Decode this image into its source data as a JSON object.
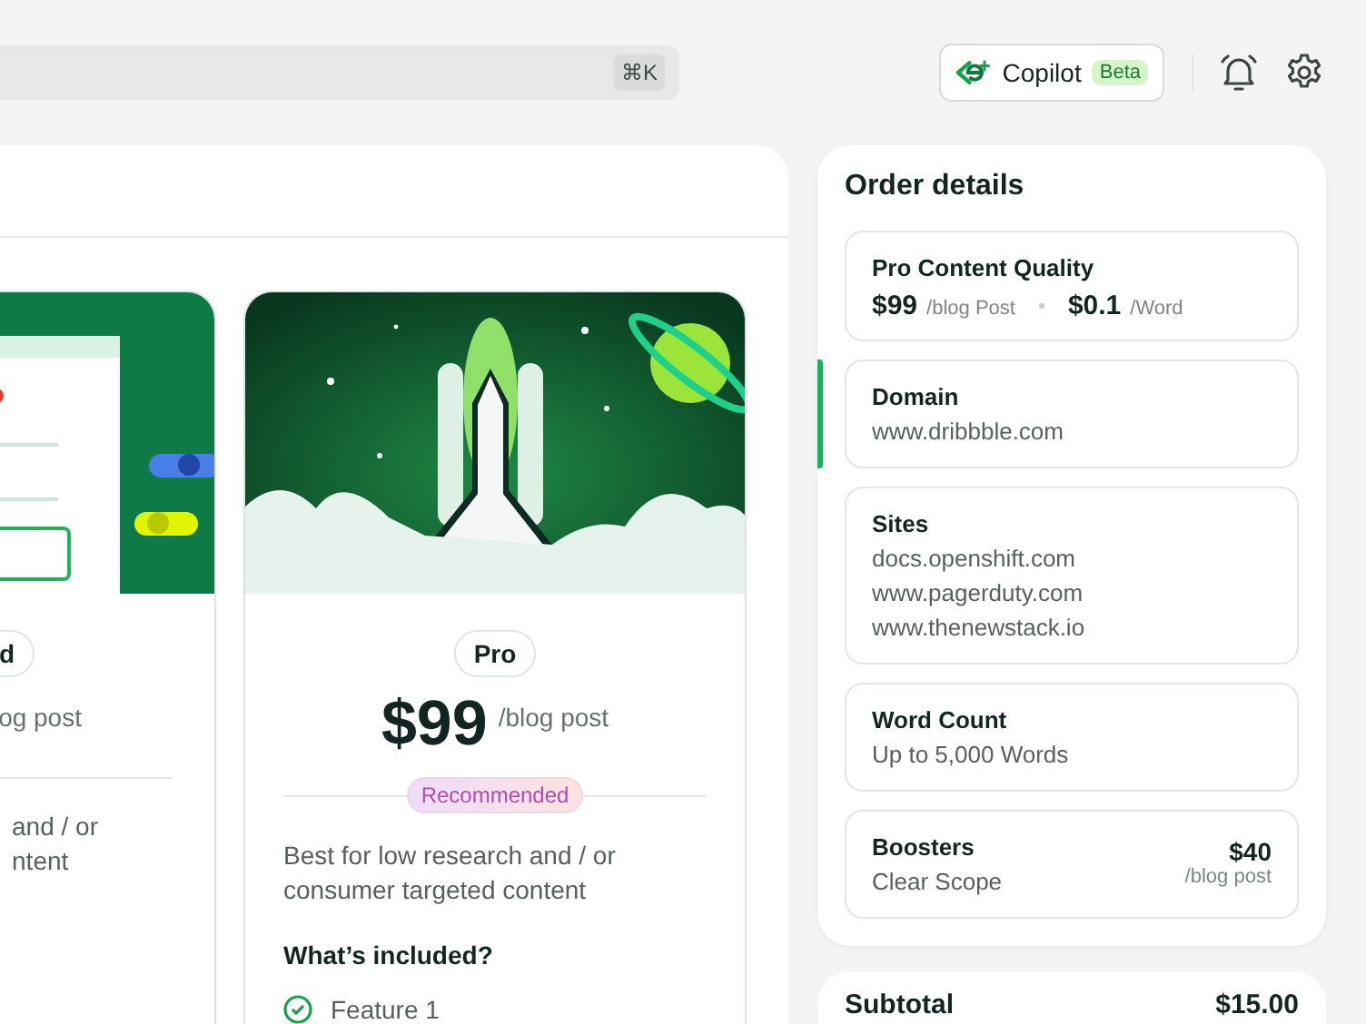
{
  "search": {
    "shortcut": "⌘K"
  },
  "copilot": {
    "label": "Copilot",
    "badge": "Beta"
  },
  "plans": [
    {
      "kind": "dashboard",
      "name": "d",
      "unit": "og post",
      "description": "and / or\nntent"
    },
    {
      "kind": "rocket",
      "name": "Pro",
      "price": "$99",
      "unit": "/blog post",
      "badge": "Recommended",
      "description": "Best for low research and / or consumer targeted content",
      "included_title": "What’s included?",
      "features": [
        "Feature 1"
      ]
    }
  ],
  "order": {
    "title": "Order details",
    "items": [
      {
        "kind": "prices",
        "title": "Pro Content Quality",
        "selected": false,
        "prices": [
          {
            "amount": "$99",
            "unit": "/blog Post"
          },
          {
            "amount": "$0.1",
            "unit": "/Word"
          }
        ]
      },
      {
        "kind": "lines",
        "title": "Domain",
        "selected": true,
        "lines": [
          "www.dribbble.com"
        ]
      },
      {
        "kind": "lines",
        "title": "Sites",
        "selected": false,
        "lines": [
          "docs.openshift.com",
          "www.pagerduty.com",
          "www.thenewstack.io"
        ]
      },
      {
        "kind": "lines",
        "title": "Word Count",
        "selected": false,
        "lines": [
          "Up to 5,000 Words"
        ]
      },
      {
        "kind": "booster",
        "title": "Boosters",
        "selected": false,
        "lines": [
          "Clear Scope"
        ],
        "amount": "$40",
        "unit": "/blog post"
      }
    ]
  },
  "subtotal": {
    "label": "Subtotal",
    "amount": "$15.00"
  }
}
